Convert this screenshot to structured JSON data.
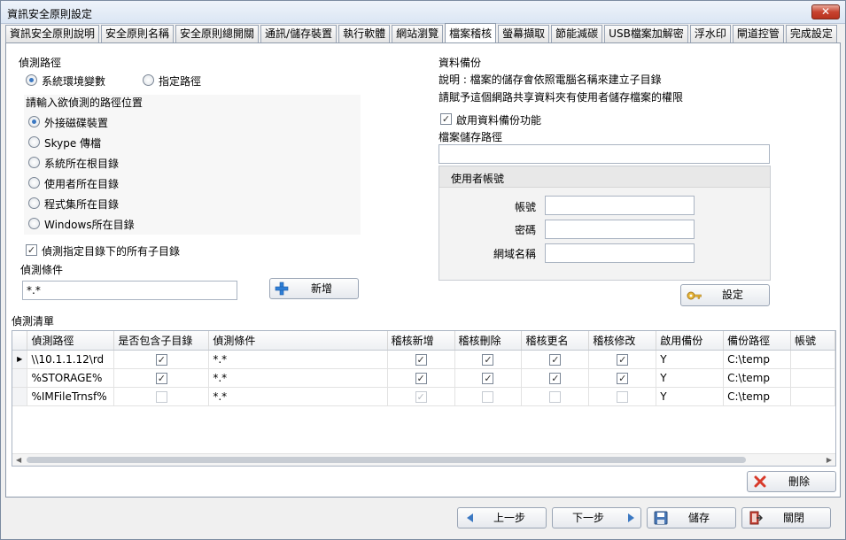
{
  "window": {
    "title": "資訊安全原則設定",
    "close_glyph": "✕"
  },
  "tabs": [
    {
      "label": "資訊安全原則說明",
      "active": false
    },
    {
      "label": "安全原則名稱",
      "active": false
    },
    {
      "label": "安全原則總開關",
      "active": false
    },
    {
      "label": "通訊/儲存裝置",
      "active": false
    },
    {
      "label": "執行軟體",
      "active": false
    },
    {
      "label": "網站瀏覽",
      "active": false
    },
    {
      "label": "檔案稽核",
      "active": true
    },
    {
      "label": "螢幕擷取",
      "active": false
    },
    {
      "label": "節能減碳",
      "active": false
    },
    {
      "label": "USB檔案加解密",
      "active": false
    },
    {
      "label": "浮水印",
      "active": false
    },
    {
      "label": "閘道控管",
      "active": false
    },
    {
      "label": "完成設定",
      "active": false
    }
  ],
  "detect_path": {
    "heading": "偵測路徑",
    "radio_env": "系統環境變數",
    "radio_custom": "指定路徑",
    "select_heading": "請輸入欲偵測的路徑位置",
    "options": [
      "外接磁碟裝置",
      "Skype 傳檔",
      "系統所在根目錄",
      "使用者所在目錄",
      "程式集所在目錄",
      "Windows所在目錄"
    ],
    "selected_index": 0,
    "include_subdirs_label": "偵測指定目錄下的所有子目錄",
    "include_subdirs_checked": true
  },
  "condition": {
    "heading": "偵測條件",
    "value": "*.*",
    "add_button": "新增"
  },
  "backup": {
    "heading": "資料備份",
    "desc1": "說明 : 檔案的儲存會依照電腦名稱來建立子目錄",
    "desc2": "請賦予這個網路共享資料夾有使用者儲存檔案的權限",
    "enable_label": "啟用資料備份功能",
    "enable_checked": true,
    "path_label": "檔案儲存路徑",
    "path_value": "",
    "account_group": "使用者帳號",
    "account_label": "帳號",
    "password_label": "密碼",
    "domain_label": "網域名稱",
    "settings_button": "設定"
  },
  "list": {
    "heading": "偵測清單",
    "columns": [
      "偵測路徑",
      "是否包含子目錄",
      "偵測條件",
      "稽核新增",
      "稽核刪除",
      "稽核更名",
      "稽核修改",
      "啟用備份",
      "備份路徑",
      "帳號"
    ],
    "rows": [
      {
        "path": "\\\\10.1.1.12\\rd",
        "subdirs": true,
        "condition": "*.*",
        "add": true,
        "del": true,
        "rename": true,
        "modify": true,
        "backup": "Y",
        "backup_path": "C:\\temp",
        "account": "",
        "current": true,
        "dim": false
      },
      {
        "path": "%STORAGE%",
        "subdirs": true,
        "condition": "*.*",
        "add": true,
        "del": true,
        "rename": true,
        "modify": true,
        "backup": "Y",
        "backup_path": "C:\\temp",
        "account": "",
        "current": false,
        "dim": false
      },
      {
        "path": "%IMFileTrnsf%",
        "subdirs": false,
        "condition": "*.*",
        "add": true,
        "del": false,
        "rename": false,
        "modify": false,
        "backup": "Y",
        "backup_path": "C:\\temp",
        "account": "",
        "current": false,
        "dim": true
      }
    ],
    "delete_button": "刪除"
  },
  "footer": {
    "prev": "上一步",
    "next": "下一步",
    "save": "儲存",
    "close": "關閉"
  },
  "colors": {
    "accent": "#3b78c2",
    "check": "#333333",
    "delete_red": "#d83a2a"
  }
}
